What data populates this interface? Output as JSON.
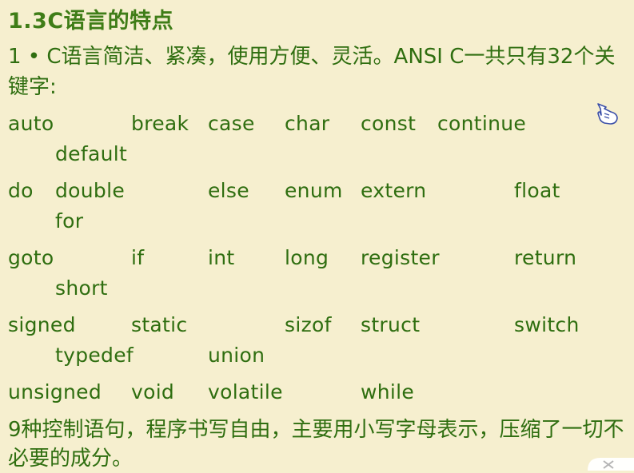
{
  "slide": {
    "title": "1.3C语言的特点",
    "intro": "1 • C语言简洁、紧凑，使用方便、灵活。ANSI C一共只有32个关键字:",
    "keyword_rows": [
      [
        "auto",
        "break",
        "case",
        "char",
        "const",
        "continue",
        "default"
      ],
      [
        "do",
        "double",
        "else",
        "enum",
        "extern",
        "float",
        "for"
      ],
      [
        "goto",
        "if",
        "int",
        "long",
        "register",
        "return",
        "short"
      ],
      [
        "signed",
        "static",
        "sizof",
        "struct",
        "switch",
        "typedef",
        "union"
      ],
      [
        "unsigned",
        "void",
        "volatile",
        "while"
      ]
    ],
    "summary": "9种控制语句，程序书写自由，主要用小写字母表示，压缩了一切不必要的成分。"
  },
  "icons": {
    "cursor": "hand-pointer-icon",
    "corner": "close-icon"
  },
  "colors": {
    "background": "#f6efcf",
    "text": "#2f6e10",
    "title": "#3f7d17"
  }
}
